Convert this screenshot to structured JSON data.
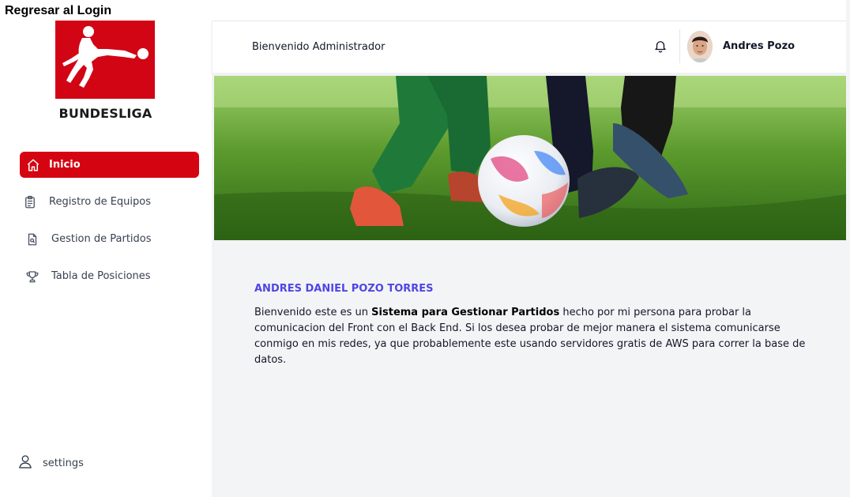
{
  "back_link": "Regresar al Login",
  "logo": {
    "text": "BUNDESLIGA",
    "color": "#d20515"
  },
  "nav": {
    "items": [
      {
        "label": "Inicio",
        "icon": "home-icon",
        "active": true
      },
      {
        "label": "Registro de Equipos",
        "icon": "clipboard-icon",
        "active": false
      },
      {
        "label": "Gestion de Partidos",
        "icon": "document-search-icon",
        "active": false
      },
      {
        "label": "Tabla de Posiciones",
        "icon": "trophy-icon",
        "active": false
      }
    ],
    "active_color": "#d40511"
  },
  "settings": {
    "label": "settings",
    "icon": "user-icon"
  },
  "header": {
    "welcome": "Bienvenido Administrador",
    "notification_icon": "bell-icon",
    "user_name": "Andres Pozo"
  },
  "content": {
    "title": "ANDRES DANIEL POZO TORRES",
    "text_before": "Bienvenido este es un ",
    "text_bold": "Sistema para Gestionar Partidos",
    "text_after": " hecho por mi persona para probar la comunicacion del Front con el Back End. Si los desea probar de mejor manera el sistema comunicarse conmigo en mis redes, ya que probablemente este usando servidores gratis de AWS para correr la base de datos.",
    "title_color": "#4f46e5"
  }
}
